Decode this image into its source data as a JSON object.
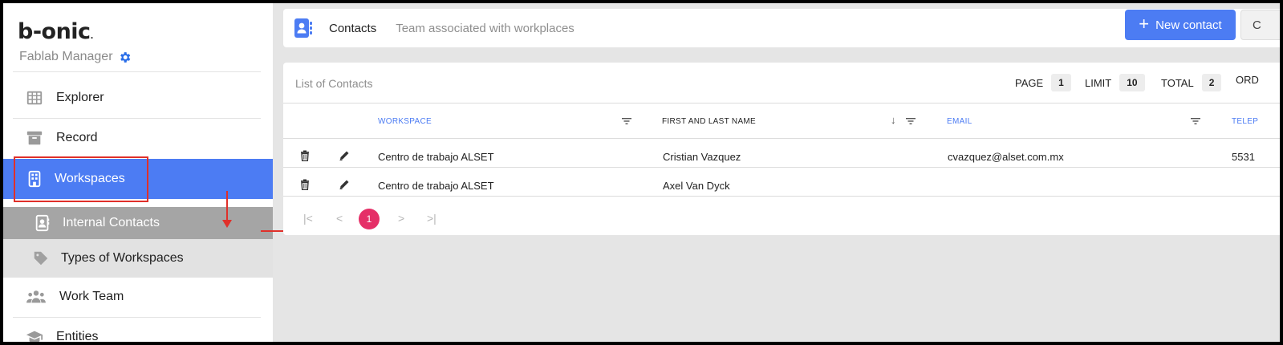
{
  "brand": {
    "logo": "b-onic",
    "logo_mark": ".",
    "subtitle": "Fablab Manager"
  },
  "sidebar": {
    "items": [
      {
        "label": "Explorer",
        "icon": "grid-icon"
      },
      {
        "label": "Record",
        "icon": "archive-icon"
      },
      {
        "label": "Workspaces",
        "icon": "building-icon"
      },
      {
        "label": "Internal Contacts",
        "icon": "contact-book-icon"
      },
      {
        "label": "Types of Workspaces",
        "icon": "tag-icon"
      },
      {
        "label": "Work Team",
        "icon": "people-icon"
      },
      {
        "label": "Entities",
        "icon": "graduation-cap-icon"
      }
    ]
  },
  "header": {
    "title": "Contacts",
    "description": "Team associated with workplaces",
    "new_button": "New contact",
    "extra_button": "C"
  },
  "list": {
    "title": "List of Contacts",
    "page_label": "PAGE",
    "page_value": "1",
    "limit_label": "LIMIT",
    "limit_value": "10",
    "total_label": "TOTAL",
    "total_value": "2",
    "order_label": "ORD"
  },
  "table": {
    "columns": [
      "WORKSPACE",
      "FIRST AND LAST NAME",
      "EMAIL",
      "TELEP"
    ],
    "rows": [
      {
        "workspace": "Centro de trabajo ALSET",
        "name": "Cristian Vazquez",
        "email": "cvazquez@alset.com.mx",
        "phone": "5531"
      },
      {
        "workspace": "Centro de trabajo ALSET",
        "name": "Axel Van Dyck",
        "email": "",
        "phone": ""
      }
    ]
  },
  "pagination": {
    "first": "|<",
    "prev": "<",
    "current": "1",
    "next": ">",
    "last": ">|"
  },
  "colors": {
    "accent": "#4c7cf3",
    "page_badge": "#e52f67",
    "annotation": "#e0302a"
  }
}
